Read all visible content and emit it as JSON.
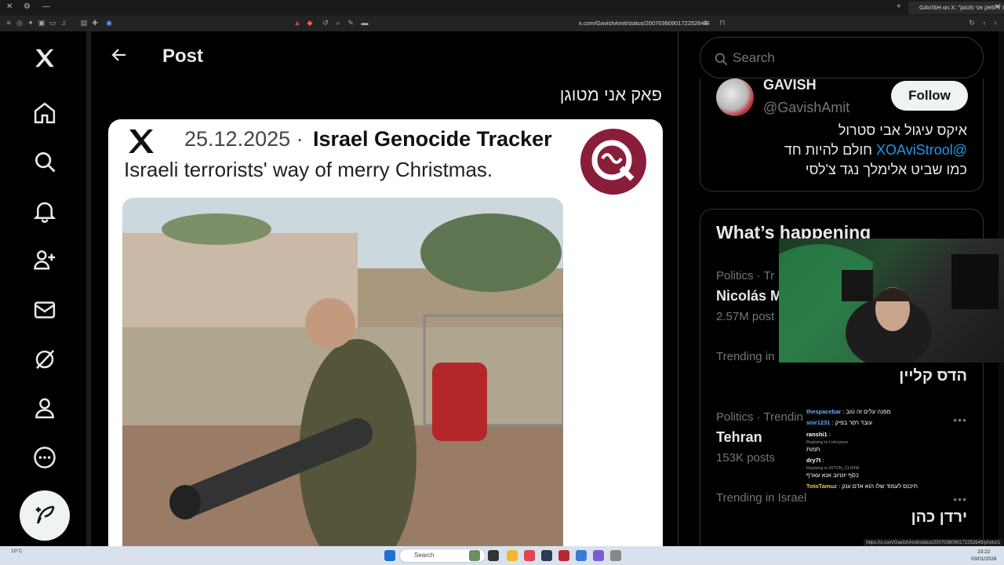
{
  "browser": {
    "tab_title": "GAVISH on X: \"פאק אני מטוגן\" / X",
    "url": "x.com/GavishAmit/status/2007036090172252649",
    "status_url": "https://x.com/GavishAmit/status/2007036090172252649/photo/1"
  },
  "nav": {
    "items": [
      "home",
      "explore",
      "notifications",
      "communities",
      "messages",
      "grok",
      "profile",
      "more"
    ],
    "post_button_icon": "feather-plus-icon"
  },
  "main": {
    "header_title": "Post",
    "post_text": "פאק אני מטוגן",
    "media": {
      "date": "25.12.2025 ·",
      "source": "Israel Genocide Tracker",
      "caption": "Israeli terrorists' way of merry Christmas."
    }
  },
  "sidebar": {
    "search_placeholder": "Search",
    "profile": {
      "name": "GAVISH",
      "handle": "@GavishAmit",
      "follow_label": "Follow",
      "bio_line1": "איקס עיגול אבי סטרול",
      "bio_link": "@XOAviStrool",
      "bio_line2_rest": " חולם להיות חד",
      "bio_line3": "כמו שביט אלימלך נגד צ'לסי"
    },
    "whats_happening": {
      "title": "What’s happening",
      "trends": [
        {
          "meta": "Politics · Tr",
          "name": "Nicolás M",
          "count": "2.57M post"
        },
        {
          "meta": "Trending in",
          "name": "הדס קליין",
          "count": ""
        },
        {
          "meta": "Politics · Trendin",
          "name": "Tehran",
          "count": "153K posts"
        },
        {
          "meta": "Trending in Israel",
          "name": "ירדן כהן",
          "count": ""
        }
      ],
      "more_label": "•••"
    }
  },
  "chat": {
    "messages": [
      {
        "user": "thespacebar",
        "text": "מפנה עלים זה טוב",
        "user_color": "#6ab0ff",
        "sub": ""
      },
      {
        "user": "snir1231",
        "text": "עובד רסר בפיק",
        "user_color": "#6ab0ff",
        "sub": ""
      },
      {
        "user": "ranshi1",
        "text": "תמות",
        "user_color": "#ffffff",
        "sub": "Replying to Lidorypoo"
      },
      {
        "user": "dry7t",
        "text": "כסף יוטיוב אנא עארף",
        "user_color": "#ffffff",
        "sub": "Replying to BITON_CLIPIM"
      },
      {
        "user": "TotoTamuz",
        "text": "תיכנס לעמוד שלו הוא אדם ענק",
        "user_color": "#f5c542",
        "sub": ""
      }
    ]
  },
  "taskbar": {
    "search_label": "Search",
    "weather_temp": "10°C",
    "time": "23:22",
    "date": "03/01/2026"
  }
}
